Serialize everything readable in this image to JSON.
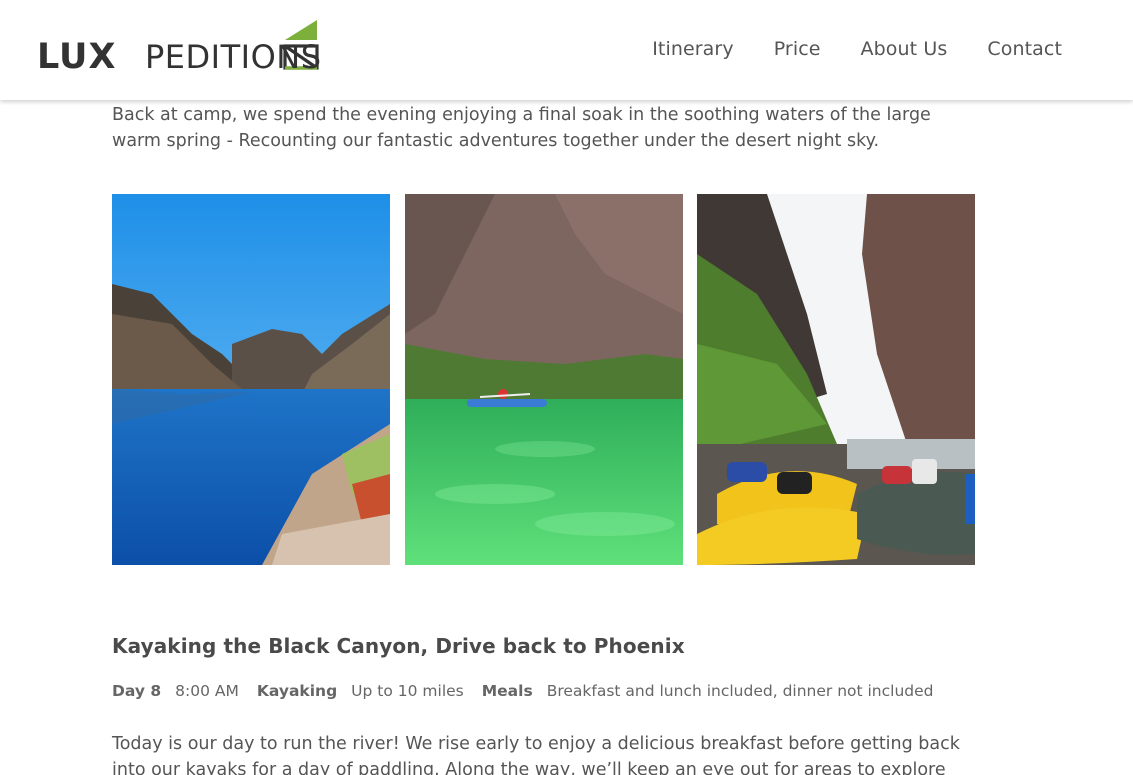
{
  "brand": {
    "name_part1": "LUX",
    "name_part2": "PEDITIONS",
    "accent_green": "#7db03a",
    "text_dark": "#333333"
  },
  "nav": {
    "items": [
      {
        "label": "Itinerary"
      },
      {
        "label": "Price"
      },
      {
        "label": "About Us"
      },
      {
        "label": "Contact"
      }
    ]
  },
  "main": {
    "intro_paragraph": "Back at camp, we spend the evening enjoying a final soak in the soothing waters of the large warm spring - Recounting our fantastic adventures together under the desert night sky.",
    "day": {
      "title": "Kayaking the Black Canyon, Drive back to Phoenix",
      "day_label": "Day 8",
      "time": "8:00 AM",
      "activity_label": "Kayaking",
      "activity_value": "Up to 10 miles",
      "meals_label": "Meals",
      "meals_value": "Breakfast and lunch included, dinner not included",
      "description": "Today is our day to run the river! We rise early to enjoy a delicious breakfast before getting back into our kayaks for a day of paddling. Along the way, we’ll keep an eye out for areas to explore along the"
    }
  }
}
